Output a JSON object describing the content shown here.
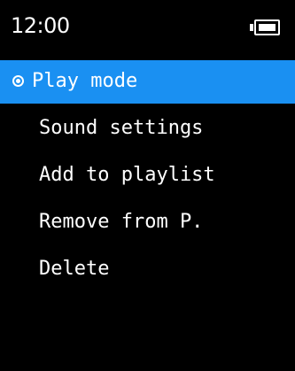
{
  "status_bar": {
    "time": "12:00",
    "battery_icon": "battery-full-icon",
    "battery_level": 1.0
  },
  "menu": {
    "selected_index": 0,
    "selected_icon": "radio-selected-icon",
    "highlight_color": "#1a90f2",
    "items": [
      {
        "label": "Play mode"
      },
      {
        "label": "Sound settings"
      },
      {
        "label": "Add to playlist"
      },
      {
        "label": "Remove from P."
      },
      {
        "label": "Delete"
      },
      {
        "label": ""
      }
    ]
  }
}
